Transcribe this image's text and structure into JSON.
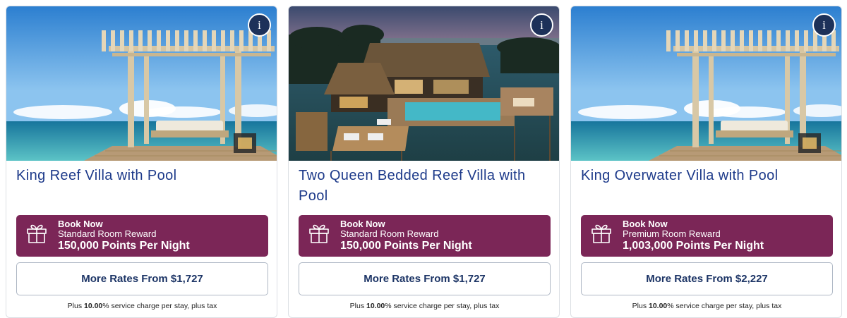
{
  "cards": [
    {
      "info_icon": "i",
      "image_name": "pergola-ocean-photo",
      "title": "King Reef Villa with Pool",
      "reward": {
        "icon": "gift-icon",
        "line1": "Book Now",
        "line2": "Standard Room Reward",
        "line3": "150,000 Points Per Night"
      },
      "rates_label": "More Rates From $1,727",
      "footnote": {
        "prefix": "Plus ",
        "rate": "10.00",
        "suffix": "% service charge per stay, plus tax"
      }
    },
    {
      "info_icon": "i",
      "image_name": "overwater-villa-pool-photo",
      "title": "Two Queen Bedded Reef Villa with Pool",
      "reward": {
        "icon": "gift-icon",
        "line1": "Book Now",
        "line2": "Standard Room Reward",
        "line3": "150,000 Points Per Night"
      },
      "rates_label": "More Rates From $1,727",
      "footnote": {
        "prefix": "Plus ",
        "rate": "10.00",
        "suffix": "% service charge per stay, plus tax"
      }
    },
    {
      "info_icon": "i",
      "image_name": "pergola-ocean-photo",
      "title": "King Overwater Villa with Pool",
      "reward": {
        "icon": "gift-icon",
        "line1": "Book Now",
        "line2": "Premium Room Reward",
        "line3": "1,003,000 Points Per Night"
      },
      "rates_label": "More Rates From $2,227",
      "footnote": {
        "prefix": "Plus ",
        "rate": "10.00",
        "suffix": "% service charge per stay, plus tax"
      }
    }
  ],
  "colors": {
    "title": "#1d3a8a",
    "reward_bg": "#7b2657",
    "rates_text": "#1d3566",
    "info_bg": "#1d3159"
  }
}
